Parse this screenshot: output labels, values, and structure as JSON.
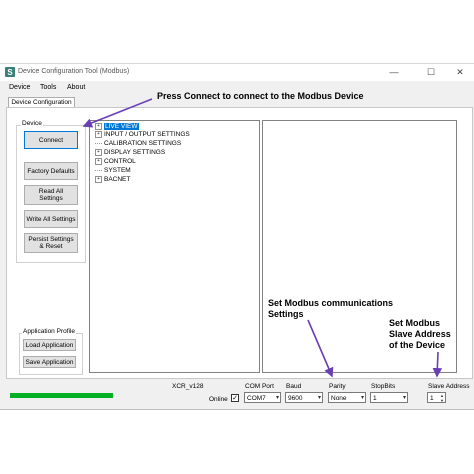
{
  "window": {
    "title": "Device Configuration Tool (Modbus)",
    "minimize_glyph": "—",
    "maximize_glyph": "☐",
    "close_glyph": "✕"
  },
  "menu": [
    "Device",
    "Tools",
    "About"
  ],
  "tab": {
    "label": "Device Configuration"
  },
  "device_group": {
    "label": "Device",
    "buttons": [
      "Connect",
      "Factory Defaults",
      "Read All\nSettings",
      "Write All Settings",
      "Persist Settings\n& Reset"
    ]
  },
  "app_profile_group": {
    "label": "Application Profile",
    "buttons": [
      "Load Application",
      "Save Application"
    ]
  },
  "tree": {
    "items": [
      {
        "label": "LIVE VIEW",
        "expander": "+",
        "selected": true
      },
      {
        "label": "INPUT / OUTPUT SETTINGS",
        "expander": "+",
        "selected": false
      },
      {
        "label": "CALIBRATION SETTINGS",
        "expander": "",
        "selected": false
      },
      {
        "label": "DISPLAY SETTINGS",
        "expander": "+",
        "selected": false
      },
      {
        "label": "CONTROL",
        "expander": "+",
        "selected": false
      },
      {
        "label": "SYSTEM",
        "expander": "",
        "selected": false
      },
      {
        "label": "BACNET",
        "expander": "+",
        "selected": false
      }
    ]
  },
  "annotations": {
    "connect": "Press Connect to connect to the Modbus Device",
    "comms": "Set Modbus communications\nSettings",
    "slave": "Set Modbus\nSlave Address\nof the Device"
  },
  "status": {
    "progress_fraction": 1.0,
    "progress_color": "#06b025",
    "device_id": "XCR_v128",
    "online_label": "Online",
    "online_checked": true,
    "com_port": {
      "label": "COM Port",
      "value": "COM7"
    },
    "baud": {
      "label": "Baud",
      "value": "9600"
    },
    "parity": {
      "label": "Parity",
      "value": "None"
    },
    "stopbits": {
      "label": "StopBits",
      "value": "1"
    },
    "slave_address": {
      "label": "Slave Address",
      "value": "1"
    }
  },
  "colors": {
    "selection": "#0078d7",
    "arrow": "#6a3fb5"
  }
}
